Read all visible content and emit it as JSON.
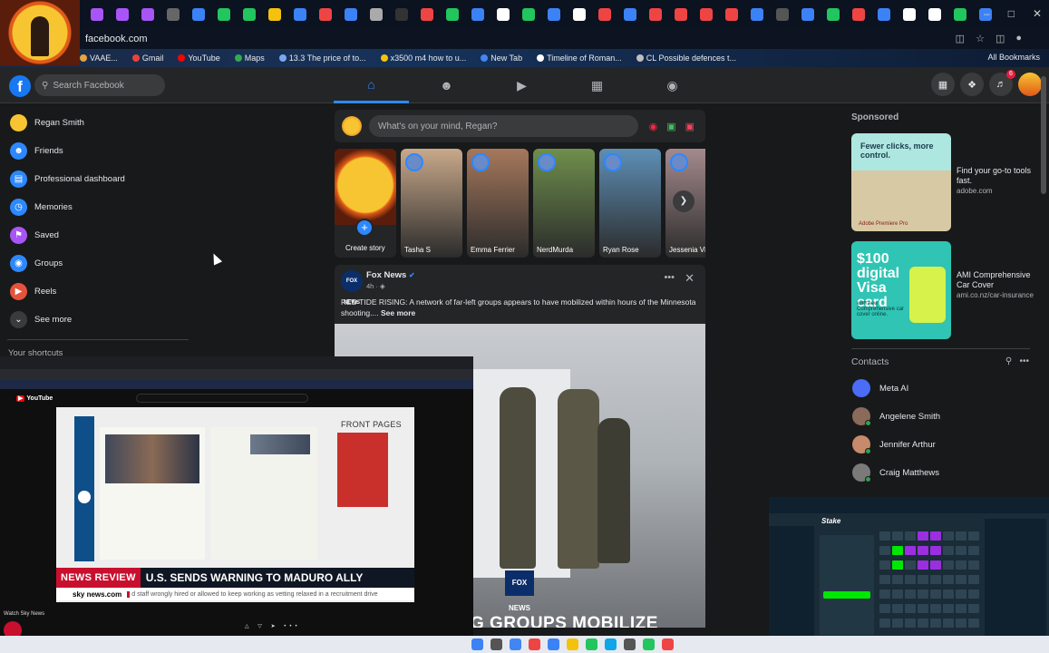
{
  "browser": {
    "url": "facebook.com",
    "bookmarks": [
      {
        "label": "VAAE...",
        "color": "#e8a33d"
      },
      {
        "label": "Gmail",
        "color": "#ea4335"
      },
      {
        "label": "YouTube",
        "color": "#ff0000"
      },
      {
        "label": "Maps",
        "color": "#34a853"
      },
      {
        "label": "13.3 The price of to...",
        "color": "#7aa7f4"
      },
      {
        "label": "x3500 m4 how to u...",
        "color": "#f4c20d"
      },
      {
        "label": "New Tab",
        "color": "#4285f4"
      },
      {
        "label": "Timeline of Roman...",
        "color": "#ffffff"
      },
      {
        "label": "CL Possible defences t...",
        "color": "#c0c0c0"
      }
    ],
    "all_bookmarks": "All Bookmarks"
  },
  "header": {
    "logo": "f",
    "search_placeholder": "Search Facebook",
    "notification_count": "6"
  },
  "sidebar": {
    "items": [
      {
        "label": "Regan Smith",
        "icon": "avatar-icon",
        "color": "#f7c531"
      },
      {
        "label": "Friends",
        "icon": "friends-icon",
        "color": "#2d88ff"
      },
      {
        "label": "Professional dashboard",
        "icon": "dashboard-icon",
        "color": "#2d88ff"
      },
      {
        "label": "Memories",
        "icon": "clock-icon",
        "color": "#2d88ff"
      },
      {
        "label": "Saved",
        "icon": "bookmark-icon",
        "color": "#a855f7"
      },
      {
        "label": "Groups",
        "icon": "groups-icon",
        "color": "#2d88ff"
      },
      {
        "label": "Reels",
        "icon": "reels-icon",
        "color": "#e5533d"
      },
      {
        "label": "See more",
        "icon": "chevron-down-icon",
        "color": "#3a3b3c"
      }
    ],
    "shortcuts_title": "Your shortcuts"
  },
  "composer": {
    "placeholder": "What's on your mind, Regan?"
  },
  "stories": [
    {
      "name": "Create story",
      "color": "#f7c531"
    },
    {
      "name": "Tasha S",
      "color": "#c9a98a"
    },
    {
      "name": "Emma Ferrier",
      "color": "#a6785c"
    },
    {
      "name": "NerdMurda",
      "color": "#6f8f4c"
    },
    {
      "name": "Ryan Rose",
      "color": "#5e8fb6"
    },
    {
      "name": "Jessenia Vic",
      "color": "#a58a8d"
    }
  ],
  "post": {
    "page": "Fox News",
    "avatar_text": "FOX NEWS",
    "time": "4h · ",
    "text": "RED TIDE RISING: A network of far-left groups appears to have mobilized within hours of the Minnesota shooting....",
    "see_more": "See more",
    "image_logo": "FOX NEWS",
    "image_headline": "G GROUPS MOBILIZE"
  },
  "right": {
    "sponsored": "Sponsored",
    "ads": [
      {
        "headline": "Find your go-to tools fast.",
        "domain": "adobe.com",
        "image_text": "Fewer clicks, more control.",
        "image_brand": "Adobe Premiere Pro"
      },
      {
        "headline": "AMI Comprehensive Car Cover",
        "domain": "ami.co.nz/car-insurance",
        "image_text": "$100 digital Visa card",
        "image_sub": "with new Comprehensive car cover online."
      }
    ],
    "contacts_title": "Contacts",
    "contacts": [
      {
        "name": "Meta AI",
        "color": "#4a6cf7",
        "online": false
      },
      {
        "name": "Angelene Smith",
        "color": "#8a6a5a",
        "online": true
      },
      {
        "name": "Jennifer Arthur",
        "color": "#c78a6a",
        "online": true
      },
      {
        "name": "Craig Matthews",
        "color": "#7a7a7a",
        "online": true
      }
    ]
  },
  "youtube_overlay": {
    "logo": "YouTube",
    "front_pages": "FRONT PAGES",
    "news_review": "NEWS REVIEW",
    "headline": "U.S. SENDS WARNING TO MADURO ALLY",
    "sky": "sky news.com",
    "ticker": "d staff wrongly hired or allowed to keep working as vetting relaxed in a recruitment drive",
    "footer": "Watch Sky News"
  },
  "stake_overlay": {
    "brand": "Stake"
  }
}
